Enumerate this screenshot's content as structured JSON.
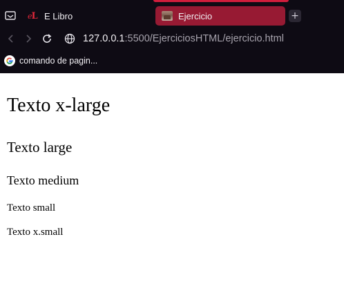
{
  "browser": {
    "tabs": [
      {
        "title": "E Libro",
        "favicon": "elibro-logo-icon",
        "active": false
      },
      {
        "title": "Ejercicio",
        "favicon": "page-thumbnail-icon",
        "active": true
      }
    ],
    "new_tab_icon": "plus-icon",
    "accent_color": "#d11d3c",
    "active_tab_color": "#971a33",
    "chrome_color": "#0e0b14",
    "url": {
      "host": "127.0.0.1",
      "rest": ":5500/EjerciciosHTML/ejercicio.html"
    },
    "bookmarks": [
      {
        "label": "comando de pagin...",
        "icon": "google-icon"
      }
    ]
  },
  "page": {
    "lines": [
      {
        "text": "Texto x-large"
      },
      {
        "text": "Texto large"
      },
      {
        "text": "Texto medium"
      },
      {
        "text": "Texto small"
      },
      {
        "text": "Texto x.small"
      }
    ]
  }
}
